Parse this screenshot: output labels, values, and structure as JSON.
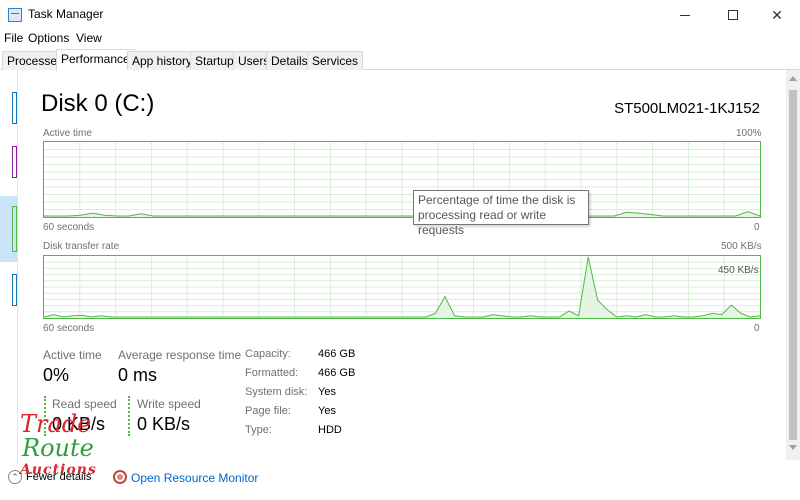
{
  "window": {
    "title": "Task Manager"
  },
  "menu": {
    "file": "File",
    "options": "Options",
    "view": "View"
  },
  "tabs": [
    "Processes",
    "Performance",
    "App history",
    "Startup",
    "Users",
    "Details",
    "Services"
  ],
  "disk": {
    "title": "Disk 0 (C:)",
    "model": "ST500LM021-1KJ152"
  },
  "active_time_graph": {
    "label": "Active time",
    "max_label": "100%",
    "time_label": "60 seconds",
    "min_label": "0",
    "y_max": 100,
    "values": [
      0,
      0,
      0,
      1,
      4,
      1,
      0,
      0,
      3,
      0,
      0,
      0,
      0,
      0,
      0,
      0,
      0,
      0,
      0,
      0,
      0,
      0,
      0,
      0,
      0,
      0,
      0,
      0,
      0,
      0,
      0,
      0,
      0,
      0,
      0,
      0,
      0,
      0,
      2,
      0,
      0,
      0,
      0,
      0,
      0,
      0,
      0,
      0,
      5,
      4,
      2,
      0,
      0,
      0,
      0,
      0,
      0,
      0,
      6,
      0
    ]
  },
  "transfer_graph": {
    "label": "Disk transfer rate",
    "max_label": "500 KB/s",
    "secondary_label": "450 KB/s",
    "time_label": "60 seconds",
    "min_label": "0",
    "y_max": 500,
    "values": [
      0,
      20,
      0,
      10,
      15,
      0,
      10,
      0,
      0,
      0,
      0,
      0,
      0,
      0,
      0,
      0,
      0,
      0,
      0,
      0,
      0,
      0,
      0,
      0,
      0,
      0,
      0,
      0,
      0,
      0,
      0,
      0,
      0,
      0,
      0,
      0,
      0,
      0,
      0,
      0,
      0,
      30,
      170,
      10,
      0,
      0,
      0,
      20,
      10,
      0,
      0,
      10,
      0,
      0,
      0,
      50,
      10,
      500,
      140,
      60,
      0,
      10,
      0,
      20,
      0,
      0,
      10,
      0,
      0,
      10,
      30,
      20,
      100,
      30,
      0,
      10
    ]
  },
  "tooltip": {
    "line1": "Percentage of time the disk is",
    "line2": "processing read or write requests"
  },
  "stats": {
    "active_time_label": "Active time",
    "active_time_value": "0%",
    "avg_response_label": "Average response time",
    "avg_response_value": "0 ms",
    "read_speed_label": "Read speed",
    "read_speed_value": "0 KB/s",
    "write_speed_label": "Write speed",
    "write_speed_value": "0 KB/s"
  },
  "properties": [
    {
      "label": "Capacity:",
      "value": "466 GB"
    },
    {
      "label": "Formatted:",
      "value": "466 GB"
    },
    {
      "label": "System disk:",
      "value": "Yes"
    },
    {
      "label": "Page file:",
      "value": "Yes"
    },
    {
      "label": "Type:",
      "value": "HDD"
    }
  ],
  "footer": {
    "fewer_details": "Fewer details",
    "resource_monitor": "Open Resource Monitor"
  },
  "watermark": {
    "line1": "Trade",
    "line2": "Route",
    "line3": "Auctions"
  },
  "colors": {
    "graph_line": "#4fb948",
    "graph_fill": "#e6f4e4",
    "graph_grid": "#d8eed5",
    "link": "#0066cc",
    "selected_thumb": "#cce4f7"
  },
  "sidebar_thumbs": [
    {
      "name": "cpu",
      "color": "#1177bb"
    },
    {
      "name": "memory",
      "color": "#8b1e9c"
    },
    {
      "name": "disk",
      "color": "#4fb948",
      "selected": true
    },
    {
      "name": "ethernet",
      "color": "#a0522d"
    },
    {
      "name": "wifi",
      "color": "#a0522d"
    }
  ]
}
